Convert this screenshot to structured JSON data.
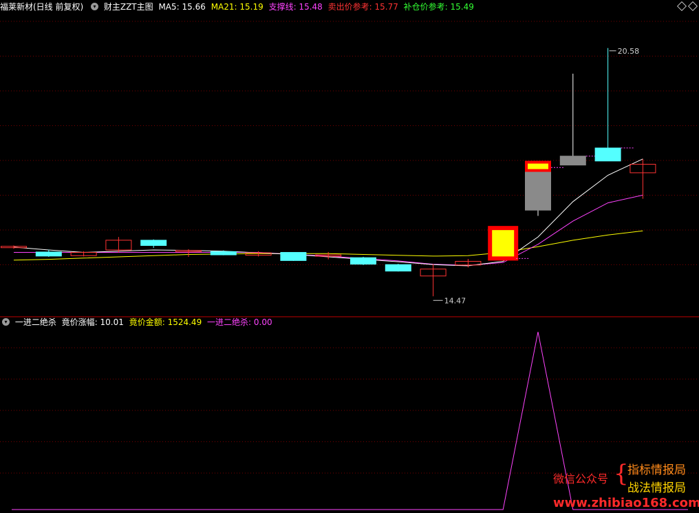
{
  "top_header": {
    "stock": "福莱新材(日线 前复权)",
    "indicator": "财主ZZT主图",
    "ma5_label": "MA5: 15.66",
    "ma21_label": "MA21: 15.19",
    "support_label": "支撑线: 15.48",
    "sell_label": "卖出价参考: 15.77",
    "buy_label": "补仓价参考: 15.49",
    "colors": {
      "ma5": "#ffffff",
      "ma21": "#ffff00",
      "support": "#ff44ff",
      "sell": "#ff3333",
      "buy": "#33ff33"
    }
  },
  "bottom_header": {
    "indicator": "一进二绝杀",
    "bid_change_label": "竟价涨幅: 10.01",
    "bid_amount_label": "竟价金额: 1524.49",
    "signal_label": "一进二绝杀: 0.00"
  },
  "annotations": {
    "high": "20.58",
    "low": "14.47"
  },
  "watermark": {
    "wechat": "微信公众号",
    "brace": "{",
    "line1": "指标情报局",
    "line2": "战法情报局",
    "url": "www.zhibiao168.com"
  },
  "chart_data": [
    {
      "type": "candlestick",
      "title": "",
      "ylim": [
        14.0,
        21.0
      ],
      "colors": {
        "up": "#ff3333",
        "down": "#54ffff",
        "limit_up_fill": "#ffff00",
        "limit_up_border": "#ff0000",
        "gray": "#8a8a8a",
        "ma5": "#ffffff",
        "ma21": "#ffff00",
        "support": "#ff44ff"
      },
      "candles": [
        {
          "open": 15.7,
          "high": 15.72,
          "low": 15.64,
          "close": 15.68,
          "style": "up"
        },
        {
          "open": 15.56,
          "high": 15.62,
          "low": 15.44,
          "close": 15.46,
          "style": "down"
        },
        {
          "open": 15.47,
          "high": 15.58,
          "low": 15.45,
          "close": 15.55,
          "style": "up"
        },
        {
          "open": 15.61,
          "high": 15.93,
          "low": 15.55,
          "close": 15.85,
          "style": "up"
        },
        {
          "open": 15.85,
          "high": 15.87,
          "low": 15.66,
          "close": 15.72,
          "style": "down"
        },
        {
          "open": 15.58,
          "high": 15.63,
          "low": 15.44,
          "close": 15.6,
          "style": "up"
        },
        {
          "open": 15.57,
          "high": 15.6,
          "low": 15.48,
          "close": 15.49,
          "style": "down"
        },
        {
          "open": 15.48,
          "high": 15.58,
          "low": 15.45,
          "close": 15.54,
          "style": "up"
        },
        {
          "open": 15.55,
          "high": 15.55,
          "low": 15.34,
          "close": 15.35,
          "style": "down"
        },
        {
          "open": 15.47,
          "high": 15.56,
          "low": 15.38,
          "close": 15.49,
          "style": "up"
        },
        {
          "open": 15.42,
          "high": 15.44,
          "low": 15.24,
          "close": 15.26,
          "style": "down"
        },
        {
          "open": 15.25,
          "high": 15.27,
          "low": 15.08,
          "close": 15.09,
          "style": "down"
        },
        {
          "open": 14.97,
          "high": 15.26,
          "low": 14.47,
          "close": 15.14,
          "style": "up"
        },
        {
          "open": 15.24,
          "high": 15.39,
          "low": 15.18,
          "close": 15.33,
          "style": "up"
        },
        {
          "open": 15.4,
          "high": 16.15,
          "low": 15.34,
          "close": 16.15,
          "style": "limit"
        },
        {
          "open": 16.59,
          "high": 17.77,
          "low": 16.45,
          "close": 17.64,
          "style": "gray",
          "cap": true
        },
        {
          "open": 17.7,
          "high": 19.95,
          "low": 17.7,
          "close": 17.92,
          "style": "gray"
        },
        {
          "open": 17.8,
          "high": 20.58,
          "low": 17.8,
          "close": 18.12,
          "style": "down"
        },
        {
          "open": 17.51,
          "high": 17.85,
          "low": 16.87,
          "close": 17.72,
          "style": "up"
        }
      ],
      "ma5": [
        15.68,
        15.61,
        15.55,
        15.58,
        15.61,
        15.6,
        15.58,
        15.54,
        15.5,
        15.44,
        15.38,
        15.32,
        15.25,
        15.22,
        15.33,
        15.93,
        16.8,
        17.45,
        17.85
      ],
      "ma21": [
        15.36,
        15.38,
        15.41,
        15.44,
        15.47,
        15.5,
        15.51,
        15.52,
        15.52,
        15.52,
        15.5,
        15.48,
        15.46,
        15.47,
        15.55,
        15.69,
        15.85,
        15.98,
        16.08
      ],
      "support": [
        15.55,
        15.55,
        15.55,
        15.55,
        15.55,
        15.55,
        15.55,
        15.55,
        15.5,
        15.46,
        15.4,
        15.34,
        15.26,
        15.23,
        15.3,
        15.75,
        16.32,
        16.77,
        16.96
      ]
    },
    {
      "type": "line",
      "title": "",
      "ylim": [
        0,
        1
      ],
      "series": [
        {
          "name": "一进二绝杀",
          "color": "#ff44ff",
          "values": [
            0,
            0,
            0,
            0,
            0,
            0,
            0,
            0,
            0,
            0,
            0,
            0,
            0,
            0,
            0,
            1,
            0,
            0,
            0
          ]
        }
      ]
    }
  ]
}
